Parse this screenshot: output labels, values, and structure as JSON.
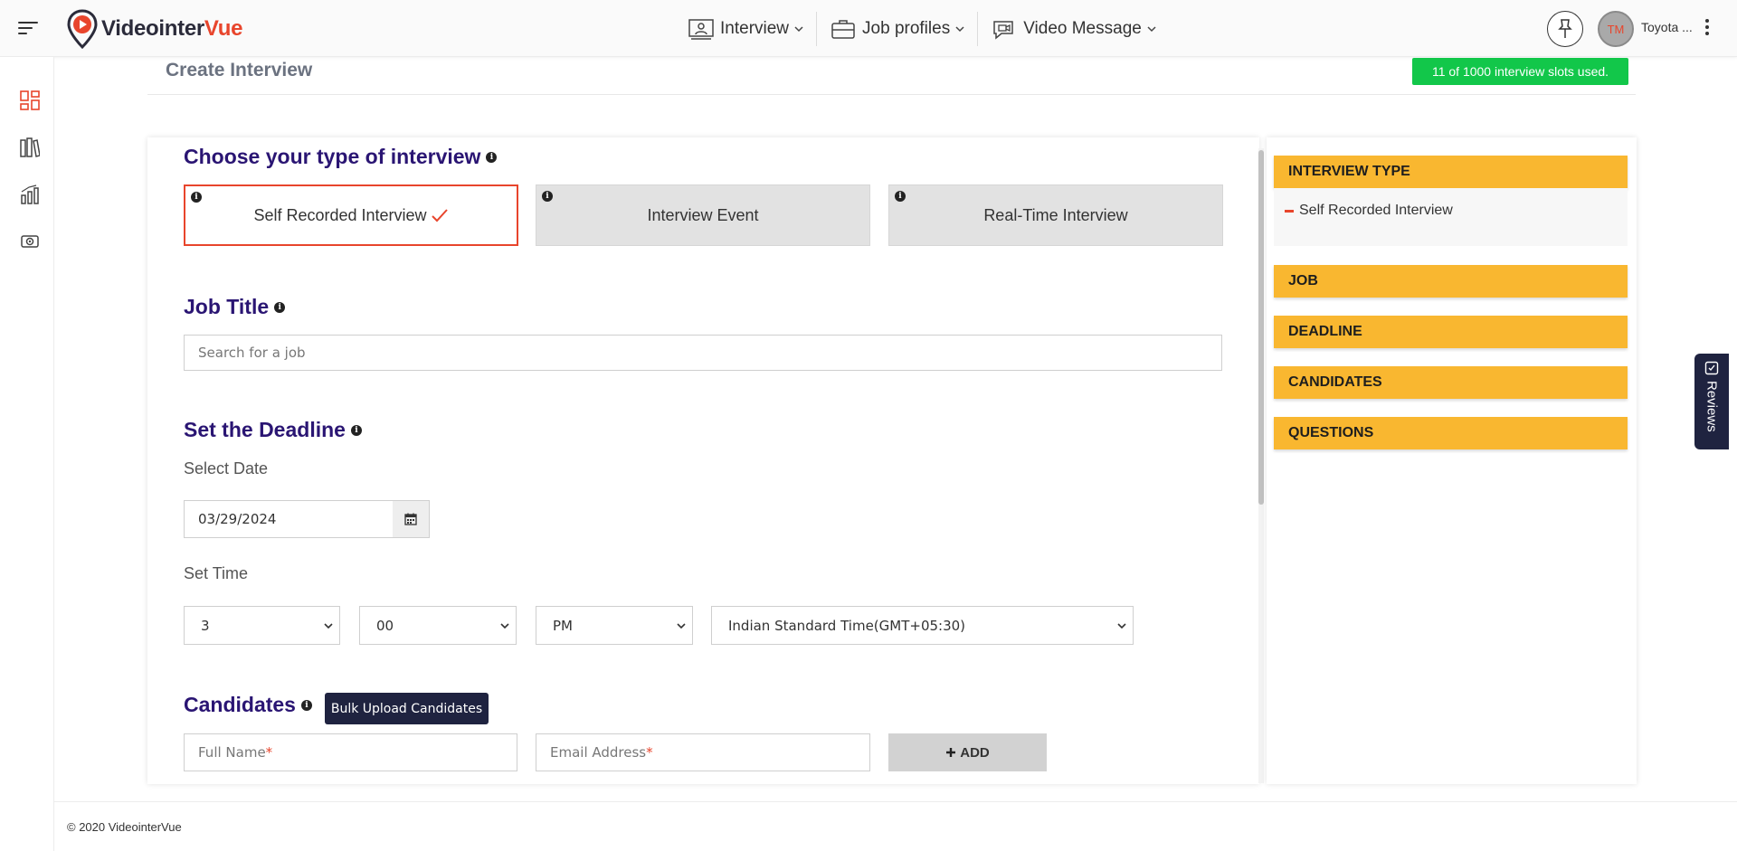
{
  "header": {
    "logo_prefix": "Videointer",
    "logo_suffix": "Vue",
    "nav": [
      {
        "label": "Interview"
      },
      {
        "label": "Job profiles"
      },
      {
        "label": "Video Message"
      }
    ],
    "avatar_initials": "TM",
    "user_name": "Toyota ..."
  },
  "page": {
    "title": "Create Interview",
    "slots_badge": "11 of 1000 interview slots used."
  },
  "interview_type": {
    "heading": "Choose your type of interview",
    "options": [
      {
        "label": "Self Recorded Interview",
        "selected": true
      },
      {
        "label": "Interview Event",
        "selected": false
      },
      {
        "label": "Real-Time Interview",
        "selected": false
      }
    ]
  },
  "job_title": {
    "heading": "Job Title",
    "placeholder": "Search for a job"
  },
  "deadline": {
    "heading": "Set the Deadline",
    "date_label": "Select Date",
    "date_value": "03/29/2024",
    "time_label": "Set Time",
    "hour": "3",
    "minute": "00",
    "ampm": "PM",
    "timezone": "Indian Standard Time(GMT+05:30)"
  },
  "candidates": {
    "heading": "Candidates",
    "bulk_upload_label": "Bulk Upload Candidates",
    "full_name_placeholder": "Full Name",
    "email_placeholder": "Email Address",
    "required_mark": "*",
    "add_label": "ADD"
  },
  "summary": {
    "sections": [
      {
        "label": "INTERVIEW TYPE"
      },
      {
        "label": "JOB"
      },
      {
        "label": "DEADLINE"
      },
      {
        "label": "CANDIDATES"
      },
      {
        "label": "QUESTIONS"
      }
    ],
    "interview_type_value": "Self Recorded Interview"
  },
  "reviews_tab": {
    "label": "Reviews"
  },
  "footer": {
    "copyright": "© 2020 VideointerVue"
  },
  "colors": {
    "accent": "#e8452c",
    "heading": "#2a1573",
    "summary_header": "#f9b730",
    "badge_green": "#12c74a",
    "dark_button": "#1f2340"
  },
  "icons": {
    "menu": "hamburger-icon",
    "pin": "pin-icon",
    "more": "kebab-menu-icon",
    "sidebar": [
      "dashboard-icon",
      "library-icon",
      "analytics-icon",
      "video-message-icon"
    ],
    "info": "info-icon",
    "check": "checkmark-icon",
    "calendar": "calendar-icon",
    "plus": "plus-icon",
    "reviews": "reviews-icon"
  }
}
